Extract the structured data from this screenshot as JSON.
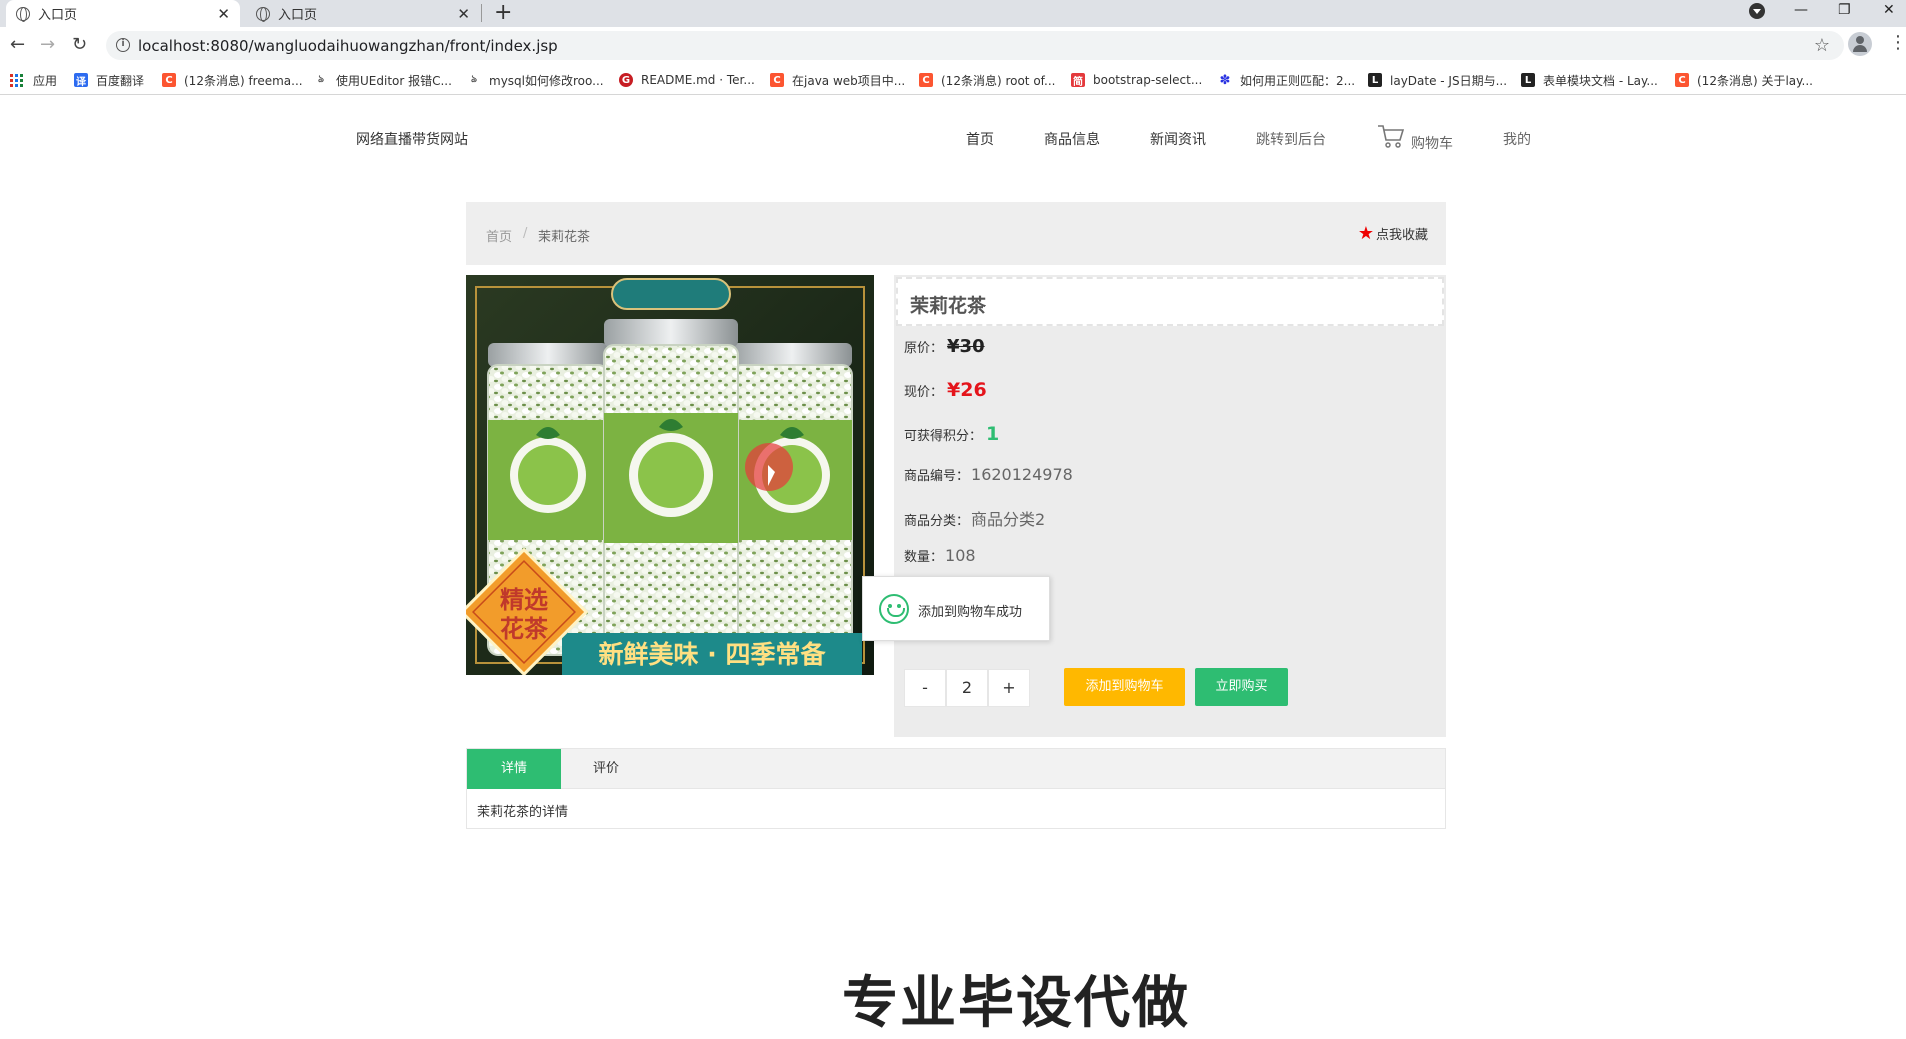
{
  "browser": {
    "tabs": [
      {
        "label": "入口页",
        "active": true
      },
      {
        "label": "入口页",
        "active": false
      }
    ],
    "url": "localhost:8080/wangluodaihuowangzhan/front/index.jsp",
    "bookmarks": [
      {
        "label": "应用",
        "icon": "apps-icon"
      },
      {
        "label": "百度翻译",
        "icon": "baidu-translate-icon",
        "color": "#2d6bf0"
      },
      {
        "label": "(12条消息) freema...",
        "icon": "csdn-icon",
        "color": "#fc5531"
      },
      {
        "label": "使用UEditor 报错C...",
        "icon": "cnblogs-icon",
        "color": "#555555"
      },
      {
        "label": "mysql如何修改roo...",
        "icon": "cnblogs-icon",
        "color": "#555555"
      },
      {
        "label": "README.md · Ter...",
        "icon": "gitee-icon",
        "color": "#c71d23"
      },
      {
        "label": "在java web项目中...",
        "icon": "csdn-icon",
        "color": "#fc5531"
      },
      {
        "label": "(12条消息) root of...",
        "icon": "csdn-icon",
        "color": "#fc5531"
      },
      {
        "label": "bootstrap-select...",
        "icon": "site-icon",
        "color": "#e4393c"
      },
      {
        "label": "如何用正则匹配：2...",
        "icon": "baidu-icon",
        "color": "#2932e1"
      },
      {
        "label": "layDate - JS日期与...",
        "icon": "layui-icon",
        "color": "#222222"
      },
      {
        "label": "表单模块文档 - Lay...",
        "icon": "layui-icon",
        "color": "#222222"
      },
      {
        "label": "(12条消息) 关于lay...",
        "icon": "csdn-icon",
        "color": "#fc5531"
      }
    ]
  },
  "site": {
    "title": "网络直播带货网站",
    "nav": [
      "首页",
      "商品信息",
      "新闻资讯",
      "跳转到后台",
      "购物车",
      "我的"
    ]
  },
  "breadcrumb": {
    "home": "首页",
    "sep": "/",
    "current": "茉莉花茶"
  },
  "favorite_label": "点我收藏",
  "product": {
    "name": "茉莉花茶",
    "orig_price_label": "原价：",
    "orig_price": "¥30",
    "price_label": "现价：",
    "price": "¥26",
    "points_label": "可获得积分：",
    "points": "1",
    "code_label": "商品编号：",
    "code": "1620124978",
    "category_label": "商品分类：",
    "category": "商品分类2",
    "stock_label": "数量：",
    "stock": "108",
    "image_texts": {
      "badge": "精选花茶",
      "banner": "新鲜美味 · 四季常备"
    }
  },
  "quantity": {
    "minus": "-",
    "value": "2",
    "plus": "+"
  },
  "buttons": {
    "add_to_cart": "添加到购物车",
    "buy_now": "立即购买"
  },
  "toast": "添加到购物车成功",
  "detail_tabs": {
    "detail": "详情",
    "review": "评价",
    "content": "茉莉花茶的详情"
  },
  "watermark": "专业毕设代做",
  "colors": {
    "green": "#2ebd72",
    "yellow": "#ffb800",
    "red": "#e4141b"
  }
}
